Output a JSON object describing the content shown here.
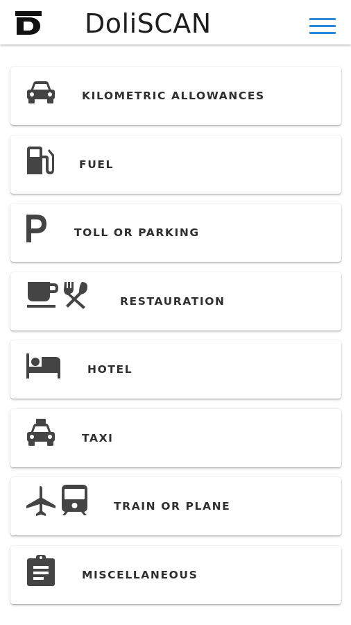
{
  "header": {
    "brand": "DoliSCAN",
    "logo_icon": "doliscan-d-logo-icon",
    "menu_icon": "hamburger-menu-icon",
    "accent_color": "#2a86d8"
  },
  "categories": [
    {
      "label": "KILOMETRIC ALLOWANCES",
      "icon": "car-icon"
    },
    {
      "label": "FUEL",
      "icon": "fuel-pump-icon"
    },
    {
      "label": "TOLL OR PARKING",
      "icon": "parking-icon"
    },
    {
      "label": "RESTAURATION",
      "icon": "coffee-cup-and-utensils-icon"
    },
    {
      "label": "HOTEL",
      "icon": "bed-icon"
    },
    {
      "label": "TAXI",
      "icon": "taxi-icon"
    },
    {
      "label": "TRAIN OR PLANE",
      "icon": "plane-and-train-icon"
    },
    {
      "label": "MISCELLANEOUS",
      "icon": "clipboard-icon"
    }
  ]
}
